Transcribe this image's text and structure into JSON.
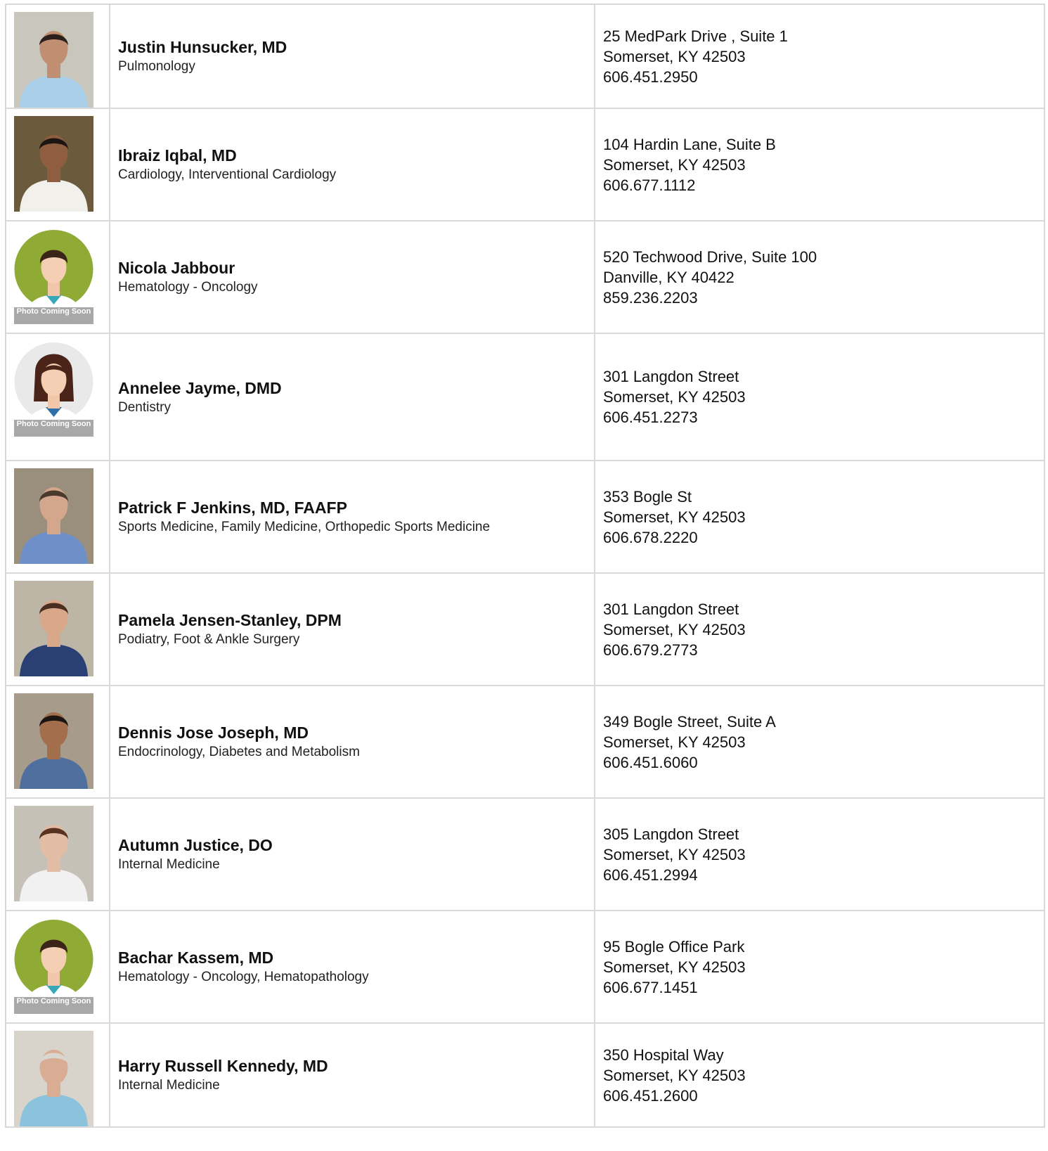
{
  "providers": [
    {
      "name": "Justin Hunsucker, MD",
      "specialty": "Pulmonology",
      "address1": "25 MedPark Drive , Suite 1",
      "address2": "Somerset, KY 42503",
      "phone": "606.451.2950",
      "photo": {
        "kind": "photo",
        "bg": "#c9c6bd",
        "shirt": "#a9cfe9",
        "skin": "#c08e70",
        "hair": "#2a1f1a"
      }
    },
    {
      "name": "Ibraiz Iqbal, MD",
      "specialty": "Cardiology, Interventional Cardiology",
      "address1": "104 Hardin Lane, Suite B",
      "address2": "Somerset, KY 42503",
      "phone": "606.677.1112",
      "photo": {
        "kind": "photo",
        "bg": "#6b5a3c",
        "shirt": "#f2f0ea",
        "skin": "#8f5e40",
        "hair": "#1c1612"
      }
    },
    {
      "name": "Nicola Jabbour",
      "specialty": "Hematology - Oncology",
      "address1": "520 Techwood Drive, Suite 100",
      "address2": "Danville, KY 40422",
      "phone": "859.236.2203",
      "photo": {
        "kind": "placeholder-male",
        "bg": "#8faa35",
        "coming_soon": "Photo Coming Soon"
      }
    },
    {
      "name": "Annelee Jayme, DMD",
      "specialty": "Dentistry",
      "address1": "301 Langdon Street",
      "address2": "Somerset, KY 42503",
      "phone": "606.451.2273",
      "photo": {
        "kind": "placeholder-female",
        "bg": "#e9e9e9",
        "coming_soon": "Photo Coming Soon"
      }
    },
    {
      "name": "Patrick F Jenkins, MD, FAAFP",
      "specialty": "Sports Medicine, Family Medicine, Orthopedic Sports Medicine",
      "address1": "353 Bogle St",
      "address2": "Somerset, KY 42503",
      "phone": "606.678.2220",
      "photo": {
        "kind": "photo",
        "bg": "#9a8f7d",
        "shirt": "#6f8fc9",
        "skin": "#d4a68b",
        "hair": "#4a3a2e"
      }
    },
    {
      "name": "Pamela Jensen-Stanley, DPM",
      "specialty": "Podiatry, Foot & Ankle Surgery",
      "address1": "301 Langdon Street",
      "address2": "Somerset, KY 42503",
      "phone": "606.679.2773",
      "photo": {
        "kind": "photo",
        "bg": "#bdb5a6",
        "shirt": "#2a3f73",
        "skin": "#d9a88a",
        "hair": "#4a2e20"
      }
    },
    {
      "name": "Dennis Jose Joseph, MD",
      "specialty": "Endocrinology, Diabetes and Metabolism",
      "address1": "349 Bogle Street, Suite A",
      "address2": "Somerset, KY 42503",
      "phone": "606.451.6060",
      "photo": {
        "kind": "photo",
        "bg": "#a79c8c",
        "shirt": "#4f6f9e",
        "skin": "#a36e4c",
        "hair": "#1a1512"
      }
    },
    {
      "name": "Autumn Justice, DO",
      "specialty": "Internal Medicine",
      "address1": "305 Langdon Street",
      "address2": "Somerset, KY 42503",
      "phone": "606.451.2994",
      "photo": {
        "kind": "photo",
        "bg": "#c6c1b6",
        "shirt": "#f1f1f1",
        "skin": "#e3bca5",
        "hair": "#5a3220"
      }
    },
    {
      "name": "Bachar Kassem, MD",
      "specialty": "Hematology - Oncology, Hematopathology",
      "address1": "95 Bogle Office Park",
      "address2": "Somerset, KY 42503",
      "phone": "606.677.1451",
      "photo": {
        "kind": "placeholder-male",
        "bg": "#8faa35",
        "coming_soon": "Photo Coming Soon"
      }
    },
    {
      "name": "Harry Russell Kennedy, MD",
      "specialty": "Internal Medicine",
      "address1": "350 Hospital Way",
      "address2": "Somerset, KY 42503",
      "phone": "606.451.2600",
      "photo": {
        "kind": "photo",
        "bg": "#d8d4cc",
        "shirt": "#8cc3dc",
        "skin": "#d9ad94",
        "hair": "#d9d6d0"
      }
    }
  ]
}
